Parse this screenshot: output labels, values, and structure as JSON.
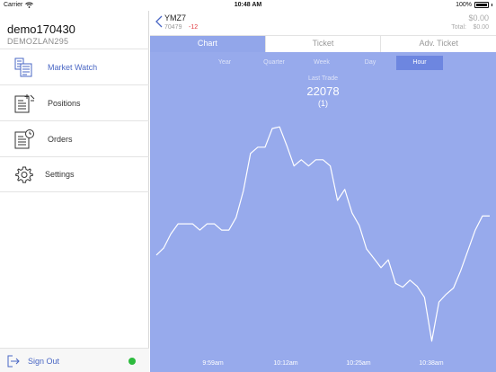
{
  "status_bar": {
    "carrier": "Carrier",
    "time": "10:48 AM",
    "battery": "100%"
  },
  "account": {
    "name": "demo170430",
    "id": "DEMOZLAN295"
  },
  "menu": [
    {
      "label": "Market Watch",
      "icon": "market-watch-icon",
      "active": true
    },
    {
      "label": "Positions",
      "icon": "positions-icon",
      "active": false
    },
    {
      "label": "Orders",
      "icon": "orders-icon",
      "active": false
    },
    {
      "label": "Settings",
      "icon": "gear-icon",
      "active": false
    }
  ],
  "sign_out": {
    "label": "Sign Out",
    "status_color": "#2dbb3e"
  },
  "instrument": {
    "symbol": "YMZ7",
    "last": "70479",
    "change": "-12"
  },
  "balance": {
    "value": "$0.00",
    "total_label": "Total:",
    "total_value": "$0.00"
  },
  "tabs": [
    {
      "label": "Chart",
      "active": true
    },
    {
      "label": "Ticket",
      "active": false
    },
    {
      "label": "Adv. Ticket",
      "active": false
    }
  ],
  "periods": [
    {
      "label": "Year",
      "active": false
    },
    {
      "label": "Quarter",
      "active": false
    },
    {
      "label": "Week",
      "active": false
    },
    {
      "label": "Day",
      "active": false
    },
    {
      "label": "Hour",
      "active": true
    }
  ],
  "last_trade": {
    "label": "Last Trade",
    "price": "22078",
    "qty": "(1)"
  },
  "colors": {
    "accent": "#4a67c4",
    "chart_bg": "#97aaec",
    "selected_period": "#6d86e0",
    "negative": "#e0393e"
  },
  "chart_data": {
    "type": "line",
    "x_ticks": [
      "9:59am",
      "10:12am",
      "10:25am",
      "10:38am"
    ],
    "series": [
      {
        "values": [
          22010,
          22019,
          22037,
          22050,
          22050,
          22050,
          22042,
          22050,
          22050,
          22042,
          22042,
          22058,
          22092,
          22140,
          22148,
          22148,
          22172,
          22174,
          22150,
          22124,
          22132,
          22124,
          22132,
          22132,
          22124,
          22080,
          22094,
          22064,
          22048,
          22018,
          22006,
          21994,
          22004,
          21974,
          21969,
          21978,
          21970,
          21956,
          21900,
          21950,
          21960,
          21968,
          21990,
          22016,
          22042,
          22060,
          22060
        ]
      }
    ]
  }
}
